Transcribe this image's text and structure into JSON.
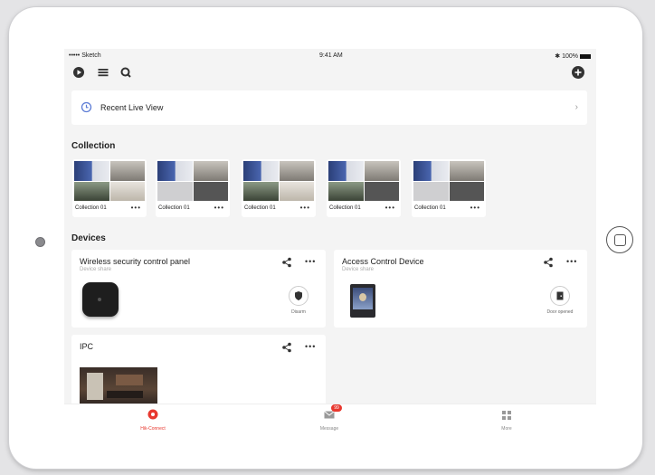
{
  "status_bar": {
    "carrier": "••••• Sketch",
    "time": "9:41 AM",
    "battery": "100%"
  },
  "recent_live_view": {
    "label": "Recent Live View"
  },
  "collection": {
    "heading": "Collection",
    "items": [
      {
        "name": "Collection 01",
        "more": "•••"
      },
      {
        "name": "Collection 01",
        "more": "•••"
      },
      {
        "name": "Collection 01",
        "more": "•••"
      },
      {
        "name": "Collection 01",
        "more": "•••"
      },
      {
        "name": "Collection 01",
        "more": "•••"
      }
    ]
  },
  "devices": {
    "heading": "Devices",
    "items": [
      {
        "title": "Wireless security control panel",
        "subtitle": "Device share",
        "action": "Disarm",
        "more": "•••"
      },
      {
        "title": "Access Control Device",
        "subtitle": "Device share",
        "action": "Door opened",
        "more": "•••"
      },
      {
        "title": "IPC",
        "subtitle": "",
        "action": "",
        "more": "•••"
      }
    ]
  },
  "tabbar": {
    "tabs": [
      {
        "label": "Hik-Connect",
        "active": true
      },
      {
        "label": "Message",
        "badge": "99"
      },
      {
        "label": "More"
      }
    ]
  },
  "colors": {
    "accent": "#e8382f",
    "clock": "#5b7bd5",
    "background": "#f4f4f4"
  }
}
